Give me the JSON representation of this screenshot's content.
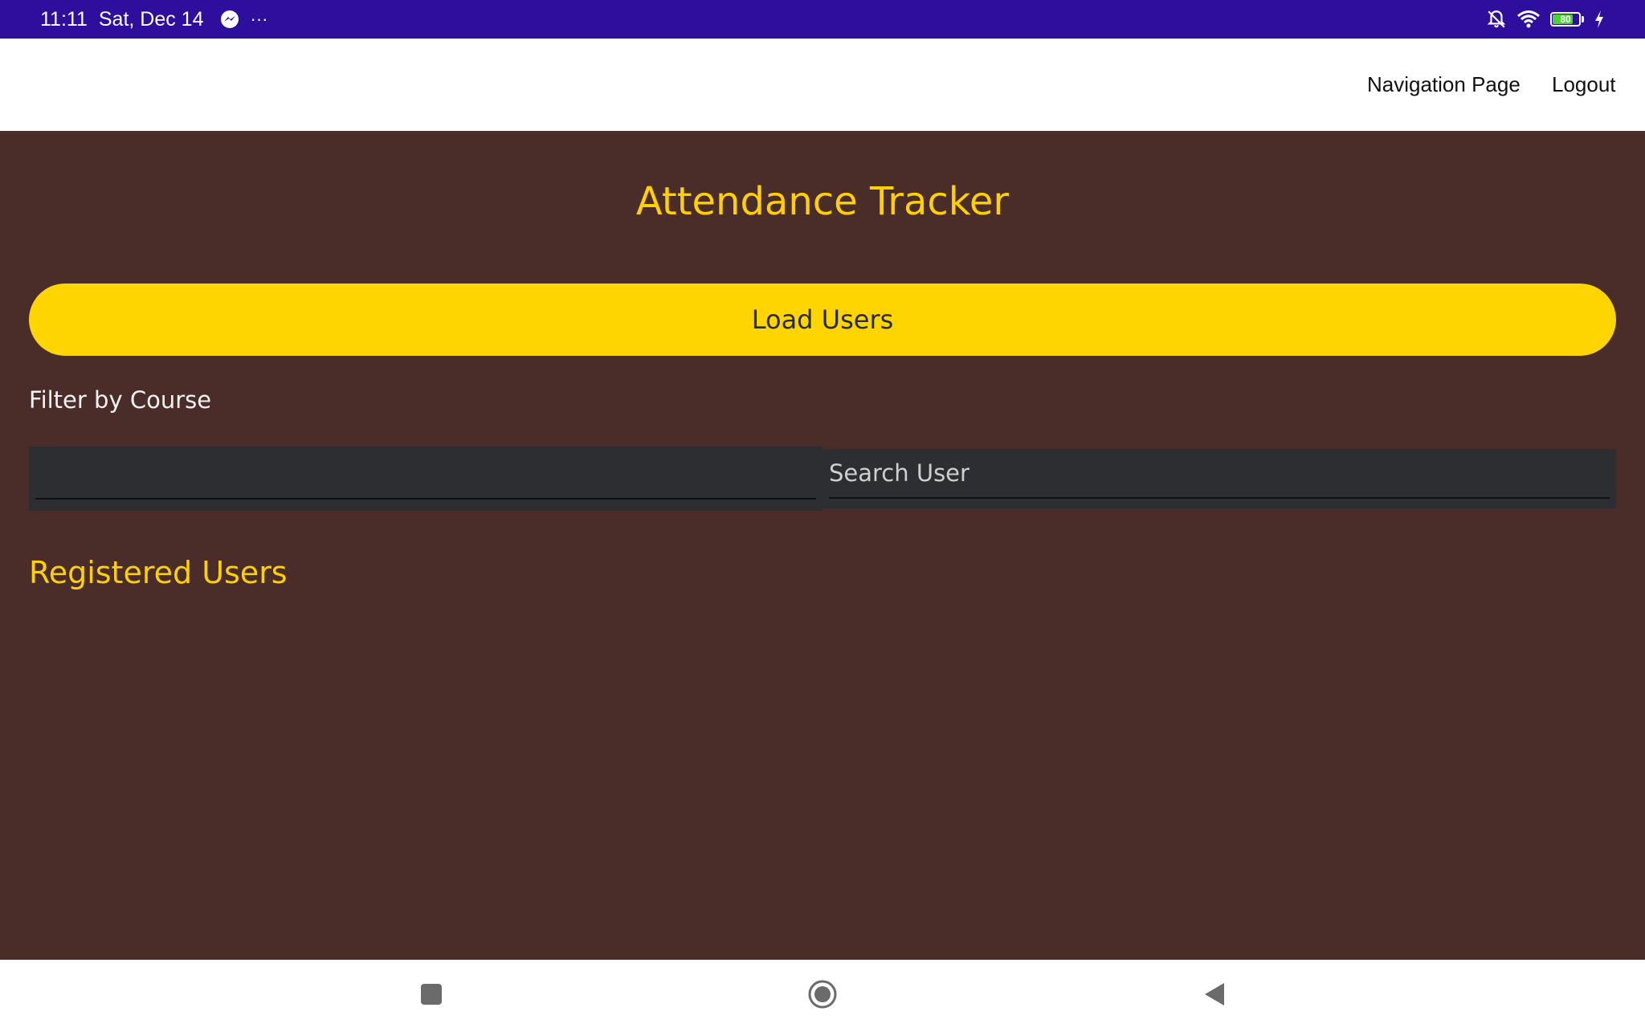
{
  "status_bar": {
    "time": "11:11",
    "date": "Sat, Dec 14",
    "more": "···",
    "battery_level": "80",
    "battery_fraction": 0.8,
    "icons": [
      "messenger-icon",
      "bell-off-icon",
      "wifi-icon",
      "battery-icon",
      "charging-icon"
    ]
  },
  "top_nav": {
    "navigation_page": "Navigation Page",
    "logout": "Logout"
  },
  "main": {
    "title": "Attendance Tracker",
    "load_button": "Load Users",
    "filter_label": "Filter by Course",
    "course_value": "",
    "search_placeholder": "Search User",
    "search_value": "",
    "registered_title": "Registered Users",
    "users": []
  },
  "nav_bar": {
    "icons": [
      "recents-square-icon",
      "home-circle-icon",
      "back-triangle-icon"
    ]
  },
  "colors": {
    "status_bar": "#2e0e9c",
    "background": "#4a2c28",
    "accent": "#ffd500",
    "title": "#ffd000",
    "field": "#2c2e31"
  }
}
